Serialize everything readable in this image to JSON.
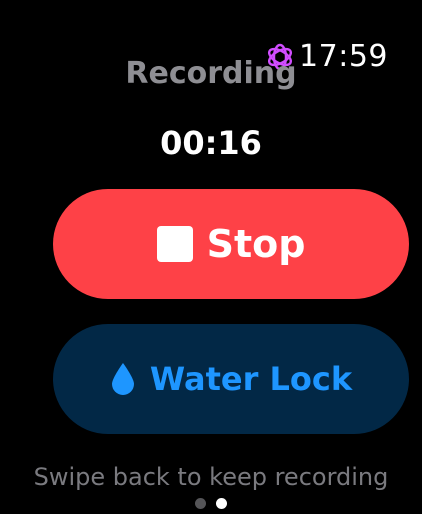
{
  "status_bar": {
    "time": "17:59",
    "activity_icon": "flower-icon",
    "activity_icon_color": "#d14dff"
  },
  "screen": {
    "title": "Recording",
    "elapsed": "00:16"
  },
  "actions": {
    "stop_label": "Stop",
    "stop_icon": "stop-square-icon",
    "stop_color": "#fe4147",
    "water_lock_label": "Water Lock",
    "water_lock_icon": "water-drop-icon",
    "water_lock_bg": "#022846",
    "water_lock_fg": "#1e96ff"
  },
  "footer": {
    "hint": "Swipe back to keep recording",
    "pages": 2,
    "current_page": 2
  }
}
